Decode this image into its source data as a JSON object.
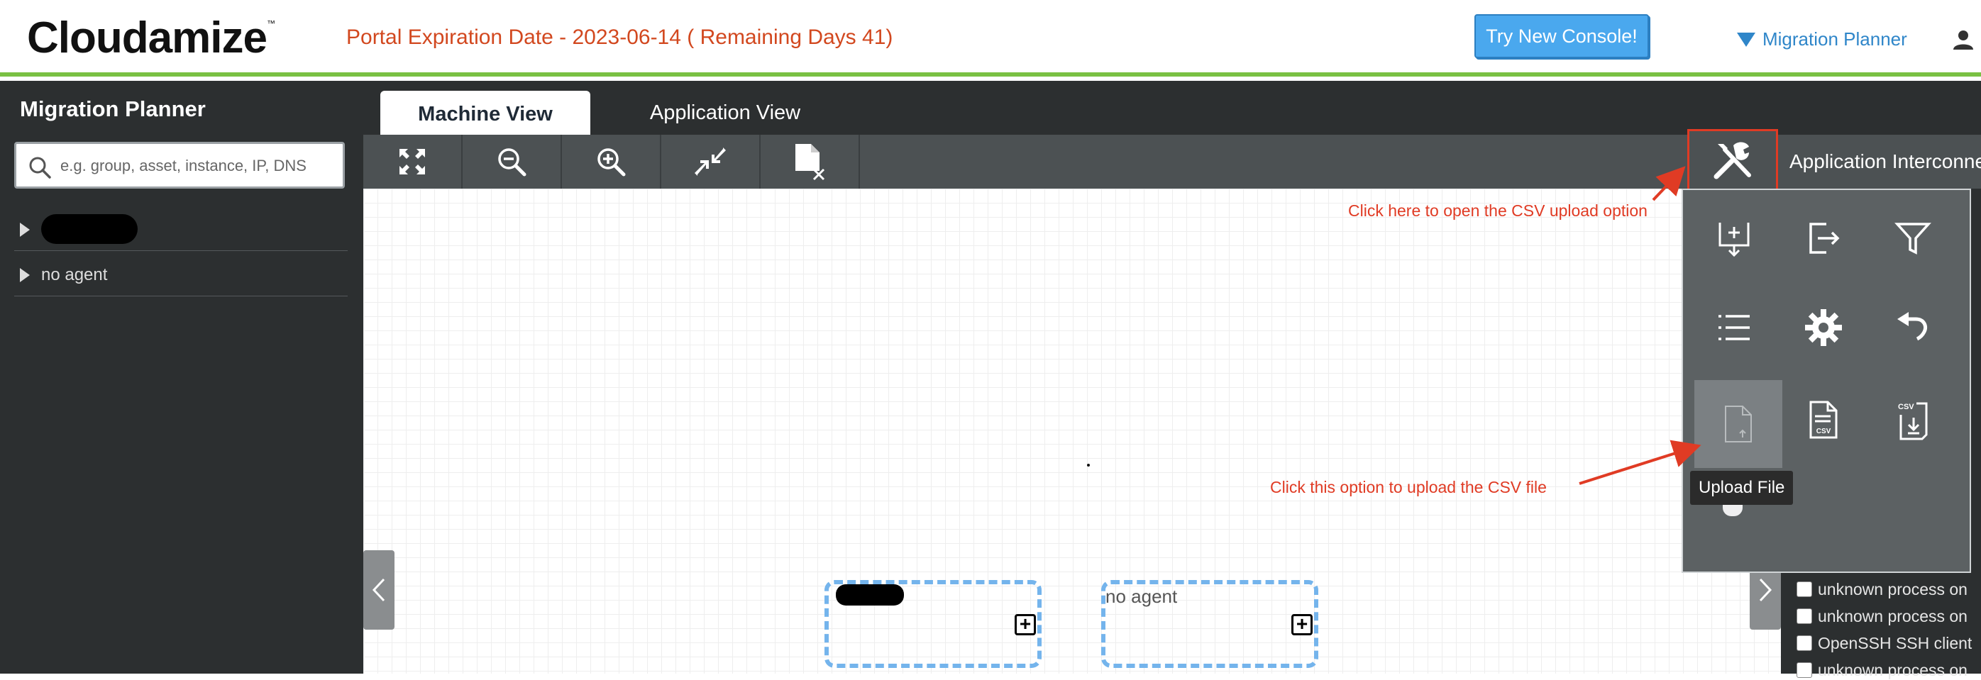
{
  "header": {
    "logo_text": "Cloudamize",
    "logo_tm": "™",
    "expiry_text": "Portal Expiration Date - 2023-06-14 ( Remaining Days 41)",
    "try_console_label": "Try New Console!",
    "nav_label": "Migration Planner",
    "accent_green": "#7ac143",
    "expiry_color": "#d2481f"
  },
  "sidebar": {
    "title": "Migration Planner",
    "search_placeholder": "e.g. group, asset, instance, IP, DNS",
    "search_value": "",
    "items": [
      {
        "label": "",
        "redacted": true
      },
      {
        "label": "no agent",
        "redacted": false
      }
    ]
  },
  "tabs": [
    {
      "label": "Machine View",
      "active": true
    },
    {
      "label": "Application View",
      "active": false
    }
  ],
  "toolbar": {
    "icons": [
      "fit-screen-icon",
      "zoom-out-icon",
      "zoom-in-icon",
      "collapse-icon",
      "remove-file-icon"
    ],
    "right_panel_title": "Application Interconne"
  },
  "canvas": {
    "groups": [
      {
        "label": "",
        "redacted": true
      },
      {
        "label": "no agent",
        "redacted": false
      }
    ]
  },
  "tools_popup": {
    "icons": [
      "import-icon",
      "export-icon",
      "filter-icon",
      "list-icon",
      "settings-icon",
      "undo-icon",
      "upload-file-icon",
      "csv-file-icon",
      "csv-download-icon"
    ],
    "tooltip": "Upload File"
  },
  "right_panel": {
    "rows": [
      "unknown process on",
      "unknown process on",
      "OpenSSH SSH client",
      "unknown process on"
    ]
  },
  "annotations": {
    "tools_hint": "Click here to open the CSV upload option",
    "upload_hint": "Click this option to upload the CSV file",
    "color": "#e03b24"
  }
}
